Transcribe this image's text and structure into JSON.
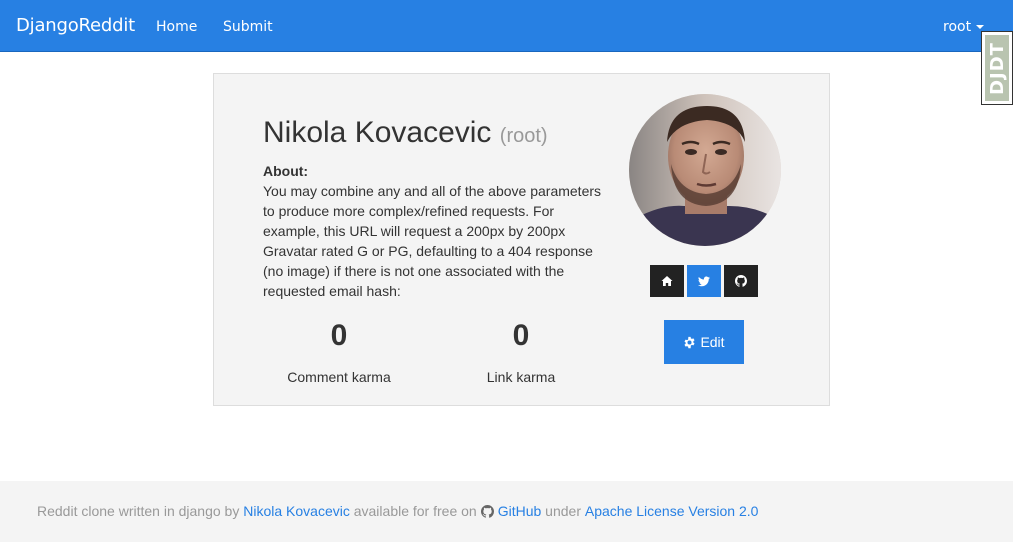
{
  "navbar": {
    "brand": "DjangoReddit",
    "links": [
      {
        "label": "Home"
      },
      {
        "label": "Submit"
      }
    ],
    "user": {
      "label": "root",
      "icon": "caret-down-icon"
    },
    "color": "#2780e3"
  },
  "debug_toolbar": {
    "label": "DJDT"
  },
  "profile": {
    "name": "Nikola Kovacevic",
    "username": "(root)",
    "about_heading": "About:",
    "about_text": "You may combine any and all of the above parameters to produce more complex/refined requests. For example, this URL will request a 200px by 200px Gravatar rated G or PG, defaulting to a 404 response (no image) if there is not one associated with the requested email hash:",
    "comment_karma": {
      "value": "0",
      "label": "Comment karma"
    },
    "link_karma": {
      "value": "0",
      "label": "Link karma"
    },
    "social": [
      {
        "icon": "home-icon"
      },
      {
        "icon": "twitter-icon"
      },
      {
        "icon": "github-icon"
      }
    ],
    "edit_label": "Edit"
  },
  "footer": {
    "prefix": "Reddit clone written in django by",
    "author_link": "Nikola Kovacevic",
    "middle": "available for free on",
    "github_link": "GitHub",
    "under": "under",
    "license_link": "Apache License Version 2.0"
  }
}
